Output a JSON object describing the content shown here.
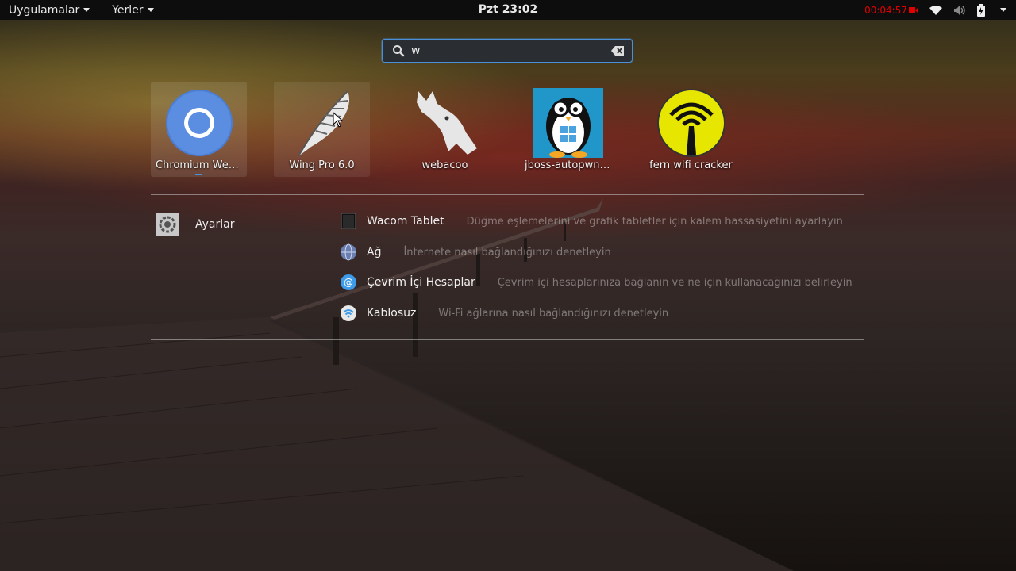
{
  "topbar": {
    "apps_menu": "Uygulamalar",
    "places_menu": "Yerler",
    "clock": "Pzt 23:02",
    "recorder_time": "00:04:57",
    "recorder_color": "#e00000",
    "icons": [
      "wifi-icon",
      "volume-icon",
      "battery-icon",
      "power-menu-caret"
    ]
  },
  "search": {
    "query": "w",
    "accent": "#4a90d9"
  },
  "apps": [
    {
      "label": "Chromium Web...",
      "icon": "chromium-icon",
      "state": "selected",
      "running": true
    },
    {
      "label": "Wing Pro 6.0",
      "icon": "wing-pro-feather-icon",
      "state": "hover",
      "running": false
    },
    {
      "label": "webacoo",
      "icon": "webacoo-dragon-icon",
      "state": "normal",
      "running": false
    },
    {
      "label": "jboss-autopwn-...",
      "icon": "jboss-penguin-icon",
      "state": "normal",
      "running": false
    },
    {
      "label": "fern wifi cracker",
      "icon": "fern-wifi-icon",
      "state": "normal",
      "running": false
    }
  ],
  "settings_provider": {
    "name": "Ayarlar",
    "icon": "settings-gear-icon"
  },
  "results": [
    {
      "name": "Wacom Tablet",
      "desc": "Düğme eşlemelerini ve grafik tabletler için kalem hassasiyetini ayarlayın",
      "icon": "wacom-tablet-icon"
    },
    {
      "name": "Ağ",
      "desc": "İnternete nasıl bağlandığınızı denetleyin",
      "icon": "network-globe-icon"
    },
    {
      "name": "Çevrim İçi Hesaplar",
      "desc": "Çevrim içi hesaplarınıza bağlanın ve ne için kullanacağınızı belirleyin",
      "icon": "online-accounts-icon"
    },
    {
      "name": "Kablosuz",
      "desc": "Wi-Fi ağlarına nasıl bağlandığınızı denetleyin",
      "icon": "wireless-icon"
    }
  ]
}
